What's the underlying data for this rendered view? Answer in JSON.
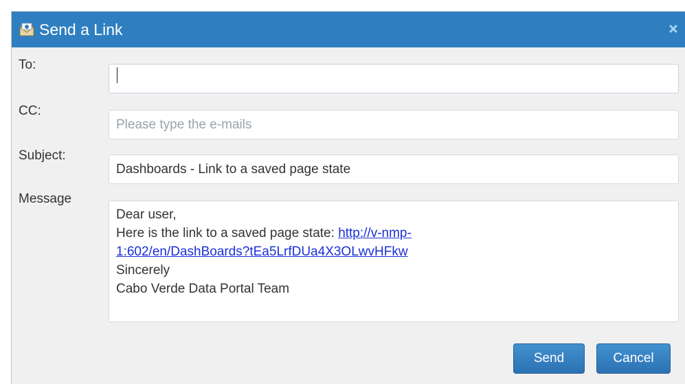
{
  "dialog": {
    "title": "Send a Link",
    "title_icon": "envelope-icon",
    "close_icon": "close-icon"
  },
  "form": {
    "to": {
      "label": "To:",
      "value": "",
      "placeholder": ""
    },
    "cc": {
      "label": "CC:",
      "value": "",
      "placeholder": "Please type the e-mails"
    },
    "subject": {
      "label": "Subject:",
      "value": "Dashboards - Link to a saved page state"
    },
    "message": {
      "label": "Message",
      "greeting": "Dear user,",
      "intro": "Here is the link to a saved page state: ",
      "link_line1": "http://v-nmp-",
      "link_line2": "1:602/en/DashBoards?tEa5LrfDUa4X3OLwvHFkw",
      "closing": "Sincerely",
      "signature": "Cabo Verde Data Portal Team"
    }
  },
  "buttons": {
    "send": "Send",
    "cancel": "Cancel"
  },
  "colors": {
    "title_bar": "#2f7fc0",
    "link": "#1a2fd6",
    "button": "#2c72b3"
  }
}
